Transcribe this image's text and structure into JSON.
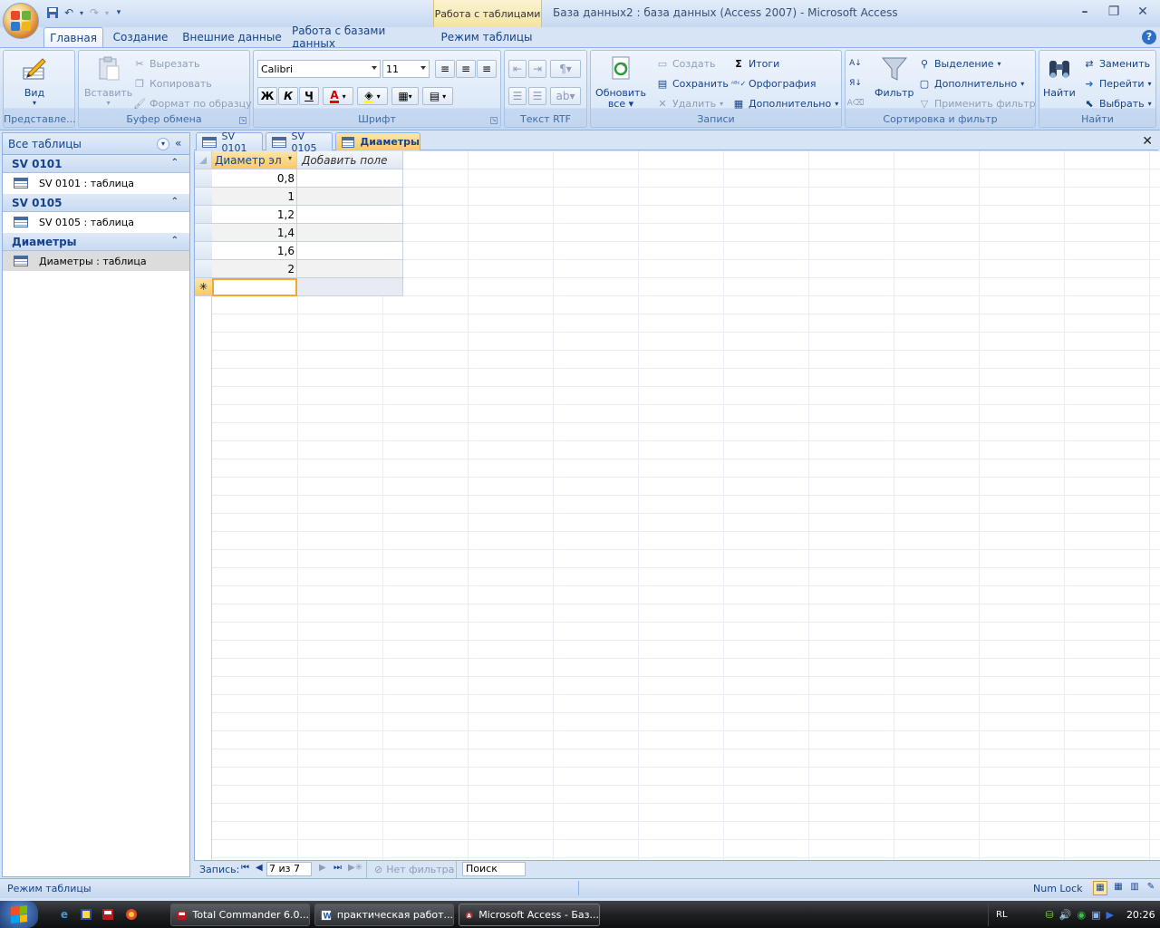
{
  "window": {
    "title": "База данных2 : база данных (Access 2007) - Microsoft Access",
    "contextual_group": "Работа с таблицами"
  },
  "ribbon_tabs": [
    "Главная",
    "Создание",
    "Внешние данные",
    "Работа с базами данных",
    "Режим таблицы"
  ],
  "ribbon": {
    "views": {
      "label": "Представле...",
      "view_button": "Вид"
    },
    "clipboard": {
      "label": "Буфер обмена",
      "paste": "Вставить",
      "cut": "Вырезать",
      "copy": "Копировать",
      "format_painter": "Формат по образцу"
    },
    "font": {
      "label": "Шрифт",
      "font_name": "Calibri",
      "font_size": "11",
      "bold": "Ж",
      "italic": "К",
      "underline": "Ч"
    },
    "rtf": {
      "label": "Текст RTF"
    },
    "records": {
      "label": "Записи",
      "refresh": "Обновить",
      "refresh_sub": "все",
      "new": "Создать",
      "save": "Сохранить",
      "delete": "Удалить",
      "totals": "Итоги",
      "spelling": "Орфография",
      "more": "Дополнительно"
    },
    "sort_filter": {
      "label": "Сортировка и фильтр",
      "filter": "Фильтр",
      "selection": "Выделение",
      "advanced": "Дополнительно",
      "toggle_filter": "Применить фильтр"
    },
    "find": {
      "label": "Найти",
      "find": "Найти",
      "replace": "Заменить",
      "goto": "Перейти",
      "select": "Выбрать"
    }
  },
  "nav_pane": {
    "header": "Все таблицы",
    "groups": [
      {
        "name": "SV 0101",
        "item": "SV 0101 : таблица"
      },
      {
        "name": "SV 0105",
        "item": "SV 0105 : таблица"
      },
      {
        "name": "Диаметры",
        "item": "Диаметры : таблица"
      }
    ]
  },
  "doc_tabs": [
    "SV 0101",
    "SV 0105",
    "Диаметры"
  ],
  "datasheet": {
    "columns": [
      "Диаметр эл",
      "Добавить поле"
    ],
    "rows": [
      "0,8",
      "1",
      "1,2",
      "1,4",
      "1,6",
      "2"
    ],
    "new_row_marker": "✳"
  },
  "record_nav": {
    "label": "Запись:",
    "position": "7 из 7",
    "filter": "Нет фильтра",
    "search": "Поиск"
  },
  "status": {
    "mode": "Режим таблицы",
    "numlock": "Num Lock"
  },
  "taskbar": {
    "tasks": [
      "Total Commander 6.0...",
      "практическая работ...",
      "Microsoft Access - Баз..."
    ],
    "lang": "RL",
    "time": "20:26"
  }
}
